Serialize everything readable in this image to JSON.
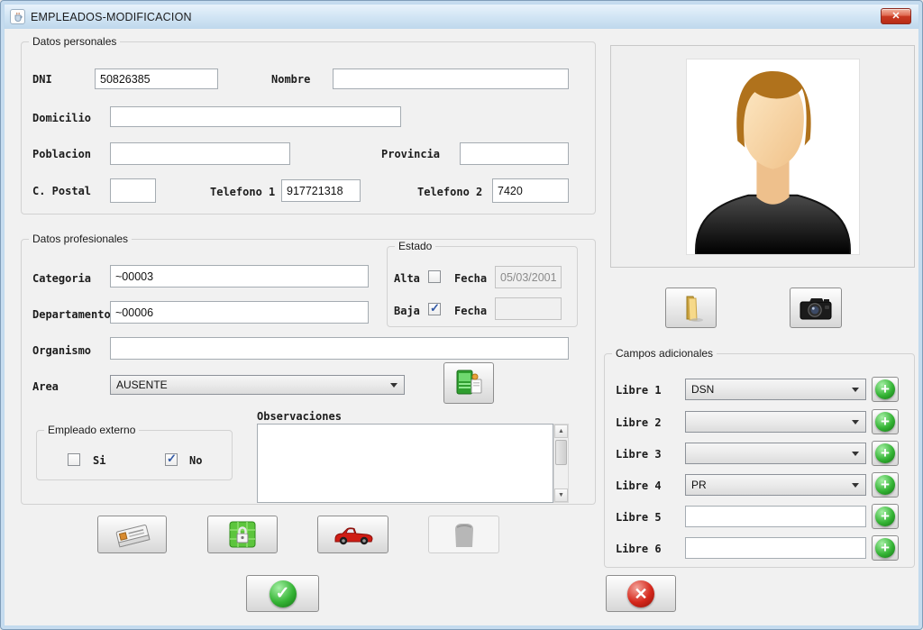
{
  "window": {
    "title": "EMPLEADOS-MODIFICACION"
  },
  "icons": {
    "close": "✕",
    "add": "+",
    "accept_check": "✓",
    "cancel_x": "✕",
    "scroll_up": "▲",
    "scroll_down": "▼",
    "app": "java-cup-icon"
  },
  "colors": {
    "window_border": "#bfd9ee",
    "titlebar": "#d4e6f5",
    "client_bg": "#f1f1f1",
    "accept_green": "#35b435",
    "cancel_red": "#d5271b",
    "add_green": "#35b435",
    "check_blue": "#3259a5"
  },
  "personal": {
    "group_title": "Datos personales",
    "dni": {
      "label": "DNI",
      "value": "50826385"
    },
    "nombre": {
      "label": "Nombre",
      "value": ""
    },
    "domicilio": {
      "label": "Domicilio",
      "value": ""
    },
    "poblacion": {
      "label": "Poblacion",
      "value": ""
    },
    "provincia": {
      "label": "Provincia",
      "value": ""
    },
    "cpostal": {
      "label": "C. Postal",
      "value": ""
    },
    "telefono1": {
      "label": "Telefono 1",
      "value": "917721318"
    },
    "telefono2": {
      "label": "Telefono 2",
      "value": "7420"
    }
  },
  "professional": {
    "group_title": "Datos profesionales",
    "categoria": {
      "label": "Categoria",
      "value": "~00003"
    },
    "departamento": {
      "label": "Departamento",
      "value": "~00006"
    },
    "organismo": {
      "label": "Organismo",
      "value": ""
    },
    "area": {
      "label": "Area",
      "value": "AUSENTE"
    },
    "estado": {
      "group_title": "Estado",
      "alta_label": "Alta",
      "alta_checked": false,
      "alta_fecha_label": "Fecha",
      "alta_fecha_value": "05/03/2001",
      "baja_label": "Baja",
      "baja_checked": true,
      "baja_fecha_label": "Fecha",
      "baja_fecha_value": ""
    },
    "externo": {
      "group_title": "Empleado externo",
      "si_label": "Si",
      "si_checked": false,
      "no_label": "No",
      "no_checked": true
    },
    "observaciones_label": "Observaciones",
    "observaciones_value": ""
  },
  "adicionales": {
    "group_title": "Campos adicionales",
    "rows": [
      {
        "label": "Libre 1",
        "type": "combo",
        "value": "DSN"
      },
      {
        "label": "Libre 2",
        "type": "combo",
        "value": ""
      },
      {
        "label": "Libre 3",
        "type": "combo",
        "value": ""
      },
      {
        "label": "Libre 4",
        "type": "combo",
        "value": "PR"
      },
      {
        "label": "Libre 5",
        "type": "text",
        "value": ""
      },
      {
        "label": "Libre 6",
        "type": "text",
        "value": ""
      }
    ]
  }
}
